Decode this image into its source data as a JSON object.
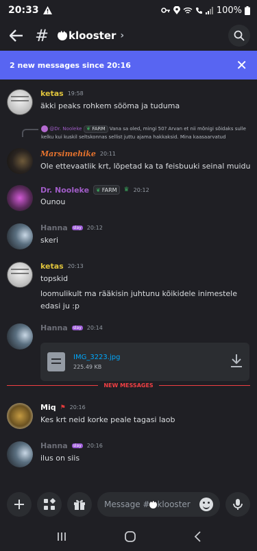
{
  "status": {
    "time": "20:33",
    "battery": "100%"
  },
  "header": {
    "channel": "klooster",
    "chevron": "›",
    "hash": "#"
  },
  "banner": {
    "text": "2 new messages since 20:16",
    "close": "✕"
  },
  "messages": [
    {
      "author": "ketas",
      "author_color": "#e0c43c",
      "time": "19:58",
      "text": "äkki peaks rohkem sööma ja tuduma"
    },
    {
      "reply_author": "@Dr. Nooleke",
      "reply_tag": "FARM",
      "reply_text": "Vana sa oled, mingi 50? Arvan et nii mõnigi sõidaks sulle kelku kui kuskil seltskonnas sellist juttu ajama hakkaksid. Mina kaasaarvatud",
      "author": "Marsimehike",
      "author_color": "#e6732e",
      "time": "20:11",
      "text": "Ole ettevaatlik krt, lõpetad ka ta feisbuuki seinal muidu"
    },
    {
      "author": "Dr. Nooleke",
      "author_color": "#a05cc7",
      "tag": "FARM",
      "time": "20:12",
      "text": "Ounou"
    },
    {
      "author": "Hanna",
      "author_color": "#6d6f78",
      "badge": "slay",
      "time": "20:12",
      "text": "skeri"
    },
    {
      "author": "ketas",
      "author_color": "#e0c43c",
      "time": "20:13",
      "text": "topskid",
      "text2": "loomulikult ma rääkisin juhtunu kõikidele inimestele edasi ju :p"
    },
    {
      "author": "Hanna",
      "author_color": "#6d6f78",
      "badge": "slay",
      "time": "20:14",
      "file_name": "IMG_3223.jpg",
      "file_size": "225.49 KB"
    },
    {
      "author": "Miq",
      "author_color": "#ffffff",
      "time": "20:16",
      "text": "Kes krt neid korke peale tagasi laob"
    },
    {
      "author": "Hanna",
      "author_color": "#6d6f78",
      "badge": "slay",
      "time": "20:16",
      "text": "ilus on siis"
    }
  ],
  "divider": {
    "label": "NEW MESSAGES"
  },
  "composer": {
    "placeholder_prefix": "Message #",
    "placeholder_channel": "klooster"
  }
}
